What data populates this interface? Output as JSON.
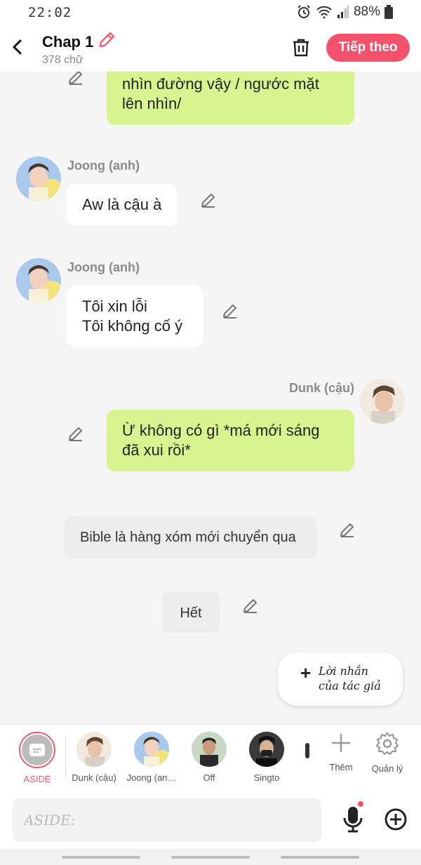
{
  "status_bar": {
    "time": "22:02",
    "battery": "88%",
    "icons": [
      "alarm-icon",
      "wifi-icon",
      "signal-icon",
      "battery-icon"
    ]
  },
  "header": {
    "title": "Chap 1",
    "word_count": "378 chữ",
    "next_label": "Tiếp theo",
    "accent_color": "#f4516c"
  },
  "messages": {
    "m1": {
      "line1": "nhìn đường vậy / ngước mặt",
      "line2": "lên nhìn/"
    },
    "m2": {
      "sender": "Joong (anh)",
      "text": "Aw là cậu à"
    },
    "m3": {
      "sender": "Joong (anh)",
      "line1": "Tôi xin lỗi",
      "line2": "Tôi không cố ý"
    },
    "m4": {
      "sender": "Dunk (cậu)",
      "line1": "Ừ không có gì  *má mới sáng",
      "line2": "đã xui rồi*"
    },
    "m5": {
      "text": "Bible là hàng xóm mới chuyển qua"
    },
    "m6": {
      "text": "Hết"
    }
  },
  "author_note": {
    "line1": "Lời nhắn",
    "line2": "của tác giả"
  },
  "characters": [
    {
      "label": "ASIDE"
    },
    {
      "label": "Dunk (cậu)"
    },
    {
      "label": "Joong (an…"
    },
    {
      "label": "Off"
    },
    {
      "label": "Singto"
    }
  ],
  "tools": {
    "add_label": "Thêm",
    "manage_label": "Quản lý"
  },
  "input": {
    "placeholder": "ASIDE:"
  },
  "colors": {
    "green_bubble": "#d6f58f",
    "accent": "#f4516c",
    "background": "#f5f5f5"
  }
}
